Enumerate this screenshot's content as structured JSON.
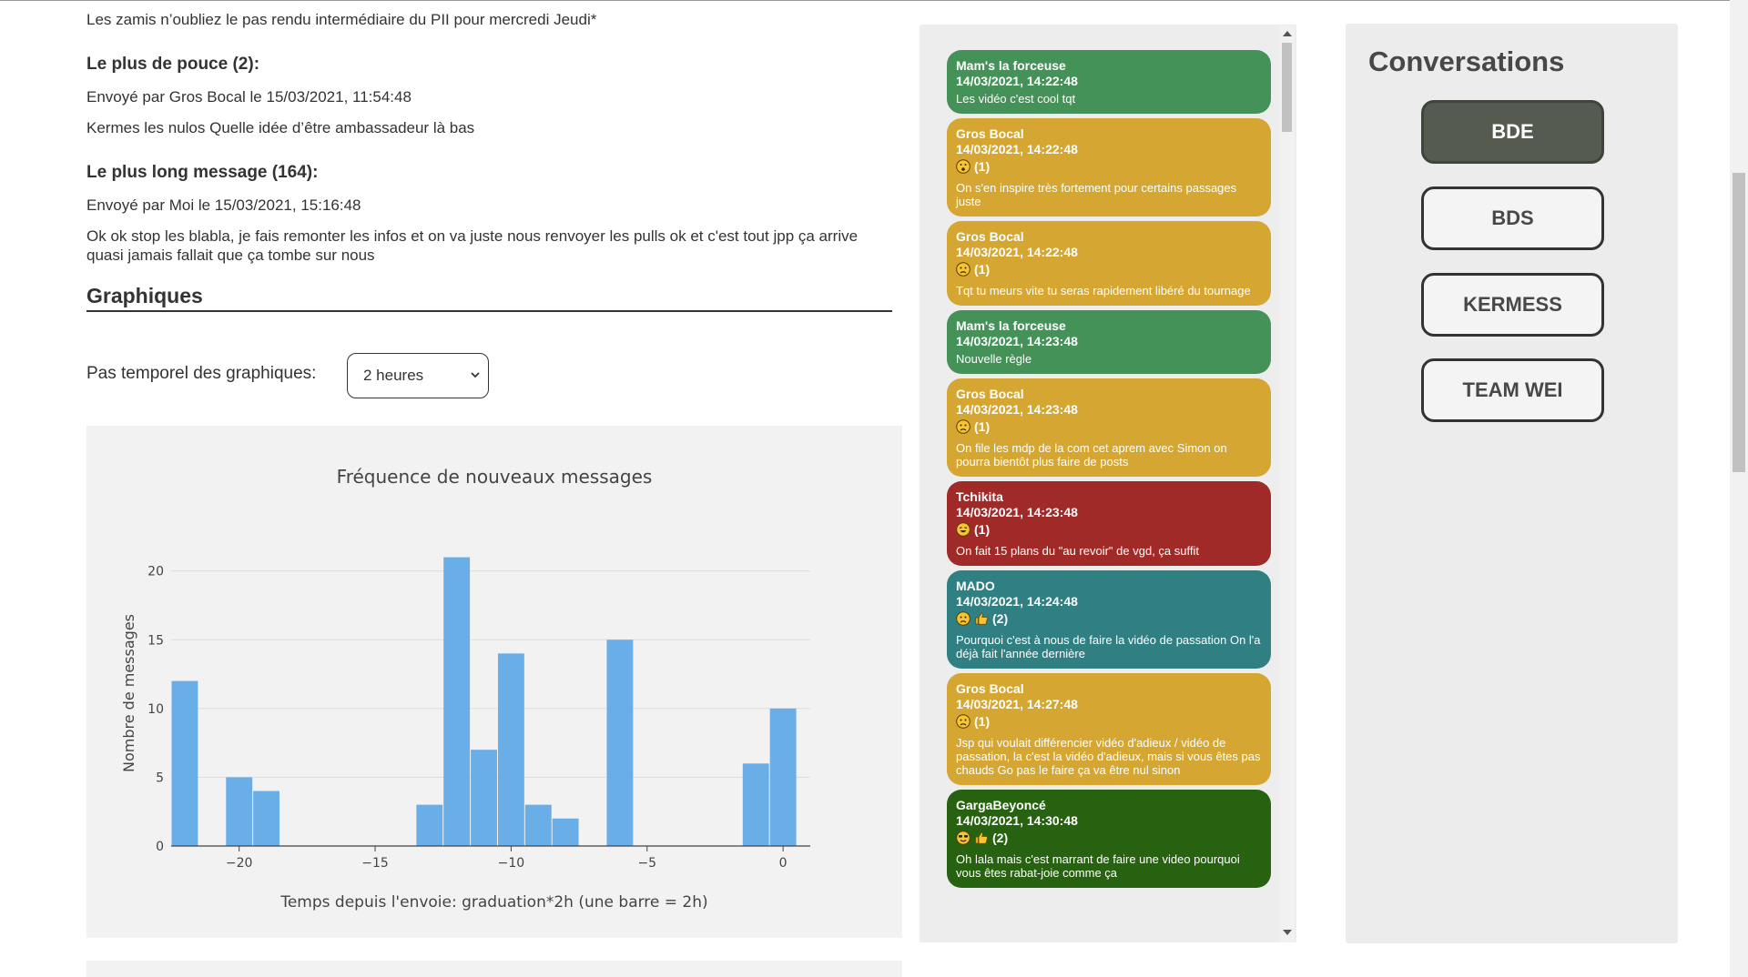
{
  "stats": {
    "intro_line": "Les zamis n’oubliez le pas rendu intermédiaire du PII pour mercredi Jeudi*",
    "most_thumbs": {
      "heading": "Le plus de pouce (2):",
      "sent_by": "Envoyé par Gros Bocal le 15/03/2021, 11:54:48",
      "text": "Kermes les nulos Quelle idée d’être ambassadeur là bas"
    },
    "longest": {
      "heading": "Le plus long message (164):",
      "sent_by": "Envoyé par Moi le 15/03/2021, 15:16:48",
      "text_line1": "Ok ok stop les blabla, je fais remonter les infos et on va juste nous renvoyer les pulls ok et c'est tout jpp ça arrive",
      "text_line2": "quasi jamais fallait que ça tombe sur nous"
    }
  },
  "graphs": {
    "heading": "Graphiques",
    "step_label": "Pas temporel des graphiques:",
    "step_value": "2 heures"
  },
  "chart_data": {
    "type": "bar",
    "title": "Fréquence de nouveaux messages",
    "xlabel": "Temps depuis l'envoie: graduation*2h (une barre = 2h)",
    "ylabel": "Nombre de messages",
    "xlim": [
      -22.5,
      1
    ],
    "ylim": [
      0,
      21.5
    ],
    "xticks": [
      -20,
      -15,
      -10,
      -5,
      0
    ],
    "xtick_labels": [
      "−20",
      "−15",
      "−10",
      "−5",
      "0"
    ],
    "yticks": [
      0,
      5,
      10,
      15,
      20
    ],
    "grid": true,
    "color": "#6aaee8",
    "x": [
      -22,
      -21,
      -20,
      -19,
      -18,
      -17,
      -16,
      -15,
      -14,
      -13,
      -12,
      -11,
      -10,
      -9,
      -8,
      -7,
      -6,
      -5,
      -4,
      -3,
      -2,
      -1,
      0
    ],
    "values": [
      12,
      0,
      5,
      4,
      0,
      0,
      0,
      0,
      0,
      3,
      21,
      7,
      14,
      3,
      2,
      0,
      15,
      0,
      0,
      0,
      0,
      6,
      10
    ]
  },
  "messages": [
    {
      "author": "Mam's la forceuse",
      "date": "14/03/2021, 14:22:48",
      "reactions": [],
      "count": "",
      "text": "Les vidéo c'est cool tqt",
      "color": "green"
    },
    {
      "author": "Gros Bocal",
      "date": "14/03/2021, 14:22:48",
      "reactions": [
        "surprised-emoji"
      ],
      "count": "(1)",
      "text": "On s'en inspire très fortement pour certains passages juste",
      "color": "gold"
    },
    {
      "author": "Gros Bocal",
      "date": "14/03/2021, 14:22:48",
      "reactions": [
        "sad-emoji"
      ],
      "count": "(1)",
      "text": "Tqt tu meurs vite tu seras rapidement libéré du tournage",
      "color": "gold"
    },
    {
      "author": "Mam's la forceuse",
      "date": "14/03/2021, 14:23:48",
      "reactions": [],
      "count": "",
      "text": "Nouvelle règle",
      "color": "green"
    },
    {
      "author": "Gros Bocal",
      "date": "14/03/2021, 14:23:48",
      "reactions": [
        "sad-emoji"
      ],
      "count": "(1)",
      "text": "On file les mdp de la com cet aprem avec Simon on pourra bientôt plus faire de posts",
      "color": "gold"
    },
    {
      "author": "Tchikita",
      "date": "14/03/2021, 14:23:48",
      "reactions": [
        "laughing-emoji"
      ],
      "count": "(1)",
      "text": "On fait 15 plans du \"au revoir\" de vgd, ça suffit",
      "color": "red"
    },
    {
      "author": "MADO",
      "date": "14/03/2021, 14:24:48",
      "reactions": [
        "sad-emoji",
        "thumbs-up-emoji"
      ],
      "count": "(2)",
      "text": "Pourquoi c'est à nous de faire la vidéo de passation On l'a déjà fait l'année dernière",
      "color": "teal"
    },
    {
      "author": "Gros Bocal",
      "date": "14/03/2021, 14:27:48",
      "reactions": [
        "sad-emoji"
      ],
      "count": "(1)",
      "text": "Jsp qui voulait différencier vidéo d'adieux / vidéo de passation, la c'est la vidéo d'adieux, mais si vous êtes pas chauds Go pas le faire ça va être nul sinon",
      "color": "gold"
    },
    {
      "author": "GargaBeyoncé",
      "date": "14/03/2021, 14:30:48",
      "reactions": [
        "cool-emoji",
        "thumbs-up-emoji"
      ],
      "count": "(2)",
      "text": "Oh lala mais c'est marrant de faire une video pourquoi vous êtes rabat-joie comme ça",
      "color": "dkgreen"
    }
  ],
  "conversations": {
    "title": "Conversations",
    "items": [
      {
        "label": "BDE",
        "active": true
      },
      {
        "label": "BDS",
        "active": false
      },
      {
        "label": "KERMESS",
        "active": false
      },
      {
        "label": "TEAM WEI",
        "active": false
      }
    ]
  }
}
